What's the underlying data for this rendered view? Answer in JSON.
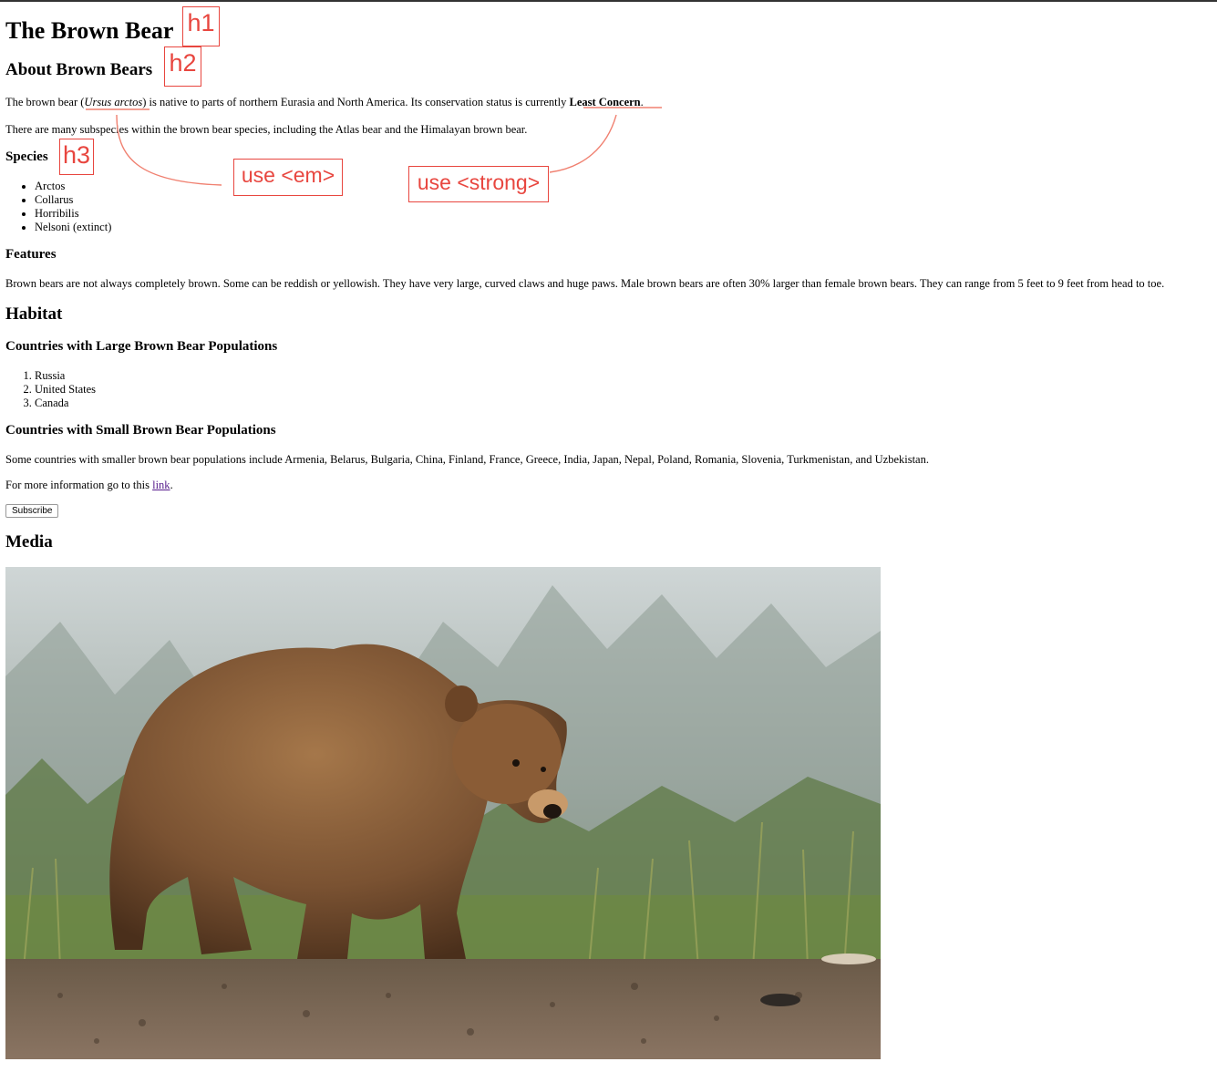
{
  "page": {
    "title": "The Brown Bear",
    "about_heading": "About Brown Bears",
    "intro": {
      "pre": "The brown bear (",
      "species_name": "Ursus arctos",
      "mid": ") is native to parts of northern Eurasia and North America. Its conservation status is currently ",
      "status": "Least Concern",
      "post": "."
    },
    "subspecies_text": "There are many subspecies within the brown bear species, including the Atlas bear and the Himalayan brown bear.",
    "species_heading": "Species",
    "species": [
      "Arctos",
      "Collarus",
      "Horribilis",
      "Nelsoni (extinct)"
    ],
    "features_heading": "Features",
    "features_text": "Brown bears are not always completely brown. Some can be reddish or yellowish. They have very large, curved claws and huge paws. Male brown bears are often 30% larger than female brown bears. They can range from 5 feet to 9 feet from head to toe.",
    "habitat_heading": "Habitat",
    "large_pop_heading": "Countries with Large Brown Bear Populations",
    "large_pop_countries": [
      "Russia",
      "United States",
      "Canada"
    ],
    "small_pop_heading": "Countries with Small Brown Bear Populations",
    "small_pop_text": "Some countries with smaller brown bear populations include Armenia, Belarus, Bulgaria, China, Finland, France, Greece, India, Japan, Nepal, Poland, Romania, Slovenia, Turkmenistan, and Uzbekistan.",
    "more_info": {
      "pre": "For more information go to this ",
      "link_text": "link",
      "post": "."
    },
    "subscribe_label": "Subscribe",
    "media_heading": "Media"
  },
  "annotations": {
    "h1_tag": "h1",
    "h2_tag": "h2",
    "h3_tag": "h3",
    "em_note": "use <em>",
    "strong_note": "use <strong>",
    "color": "#e8463f"
  },
  "icons": {
    "image": "brown-bear-photo"
  }
}
